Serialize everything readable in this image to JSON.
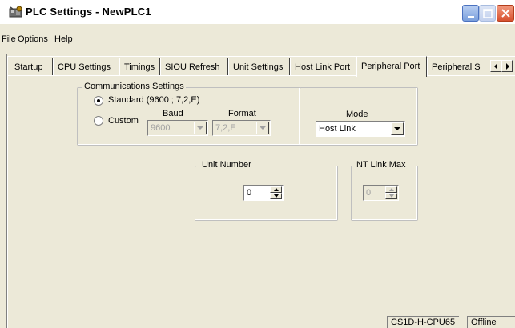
{
  "window": {
    "title": "PLC Settings - NewPLC1",
    "icon": "plc-settings-app-icon"
  },
  "titlebar_buttons": [
    "minimize-icon",
    "maximize-icon",
    "close-icon"
  ],
  "menu": [
    "File",
    "Options",
    "Help"
  ],
  "tabs": [
    {
      "label": "Startup",
      "active": false
    },
    {
      "label": "CPU Settings",
      "active": false
    },
    {
      "label": "Timings",
      "active": false
    },
    {
      "label": "SIOU Refresh",
      "active": false
    },
    {
      "label": "Unit Settings",
      "active": false
    },
    {
      "label": "Host Link Port",
      "active": false
    },
    {
      "label": "Peripheral Port",
      "active": true
    },
    {
      "label": "Peripheral S",
      "active": false
    }
  ],
  "tab_scroll": [
    "scroll-left-icon",
    "scroll-right-icon"
  ],
  "comm": {
    "group_label": "Communications Settings",
    "standard_label": "Standard (9600 ; 7,2,E)",
    "standard_checked": true,
    "custom_label": "Custom",
    "custom_checked": false,
    "baud_label": "Baud",
    "baud_value": "9600",
    "format_label": "Format",
    "format_value": "7,2,E"
  },
  "mode": {
    "label": "Mode",
    "value": "Host Link"
  },
  "unit_number": {
    "group_label": "Unit Number",
    "value": "0"
  },
  "nt_link": {
    "group_label": "NT Link Max",
    "value": "0"
  },
  "status": {
    "cpu": "CS1D-H-CPU65",
    "connection": "Offline"
  }
}
